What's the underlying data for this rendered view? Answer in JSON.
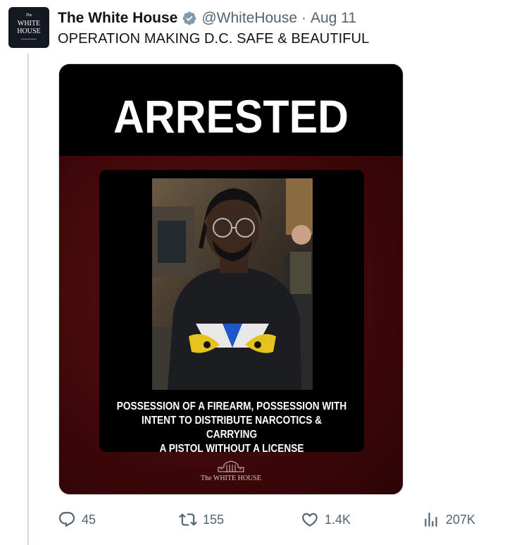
{
  "avatar": {
    "line_the": "The",
    "line1": "WHITE",
    "line2": "HOUSE"
  },
  "tweet": {
    "display_name": "The White House",
    "verified": true,
    "handle": "@WhiteHouse",
    "separator": "·",
    "date": "Aug 11",
    "text": "OPERATION MAKING D.C. SAFE & BEAUTIFUL"
  },
  "media": {
    "headline": "ARRESTED",
    "caption_lines": [
      "POSSESSION OF A FIREARM,  POSSESSION WITH",
      "INTENT TO DISTRIBUTE NARCOTICS & CARRYING",
      "A PISTOL WITHOUT A LICENSE"
    ],
    "logo_text": "The WHITE HOUSE",
    "colors": {
      "top_band": "#000000",
      "background": "#4a0b0d",
      "headline": "#ffffff"
    }
  },
  "actions": {
    "reply": {
      "icon": "reply-icon",
      "count": "45"
    },
    "retweet": {
      "icon": "retweet-icon",
      "count": "155"
    },
    "like": {
      "icon": "heart-icon",
      "count": "1.4K"
    },
    "views": {
      "icon": "views-icon",
      "count": "207K"
    }
  }
}
